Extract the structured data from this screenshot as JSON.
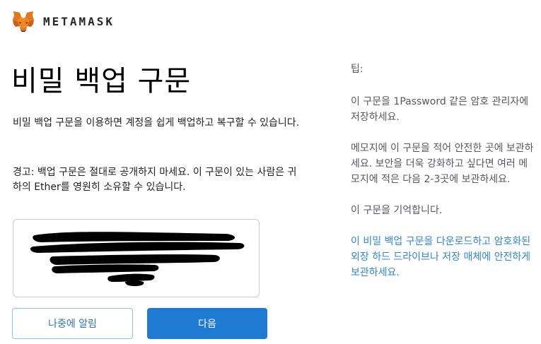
{
  "brand": {
    "name": "METAMASK",
    "logo_icon": "metamask-fox-icon"
  },
  "main": {
    "title": "비밀 백업 구문",
    "description": "비밀 백업 구문을 이용하면 계정을 쉽게 백업하고 복구할 수 있습니다.",
    "warning": "경고: 백업 구문은 절대로 공개하지 마세요. 이 구문이 있는 사람은 귀하의 Ether를 영원히 소유할 수 있습니다.",
    "secret_phrase_state": "redacted"
  },
  "buttons": {
    "remind_later": "나중에 알림",
    "next": "다음"
  },
  "tips": {
    "title": "팁:",
    "items": [
      "이 구문을 1Password 같은 암호 관리자에 저장하세요.",
      "메모지에 이 구문을 적어 안전한 곳에 보관하세요. 보안을 더욱 강화하고 싶다면 여러 메모지에 적은 다음 2-3곳에 보관하세요.",
      "이 구문을 기억합니다."
    ],
    "download_link": "이 비밀 백업 구문을 다운로드하고 암호화된 외장 하드 드라이브나 저장 매체에 안전하게 보관하세요."
  },
  "colors": {
    "primary": "#1f7bd1",
    "link": "#2f87d4",
    "secondary_border": "#8fc3ea",
    "fox_orange": "#e2761b"
  }
}
